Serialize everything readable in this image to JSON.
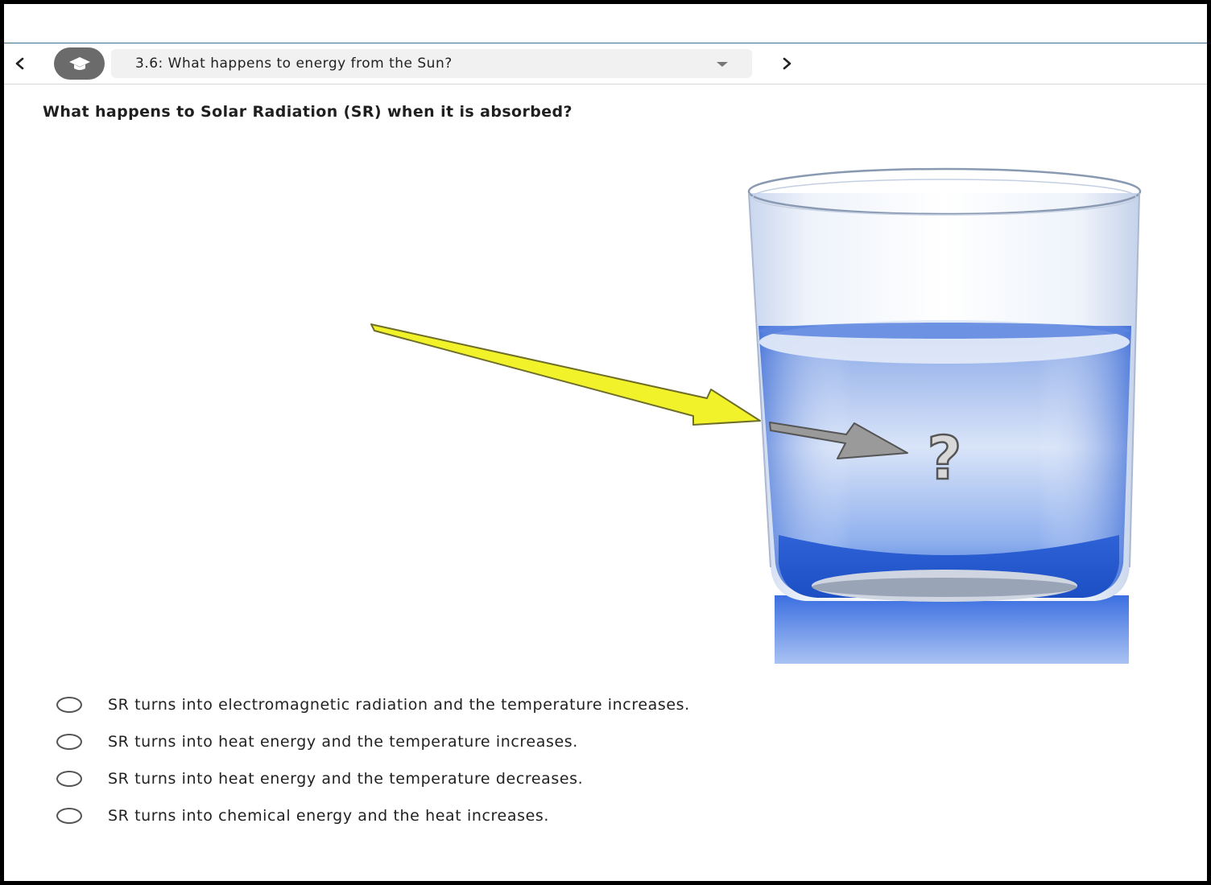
{
  "navbar": {
    "prev_icon": "chevron-left",
    "next_icon": "chevron-right",
    "cap_icon": "graduation-cap",
    "lesson_title": "3.6: What happens to energy from the Sun?"
  },
  "question": {
    "text": "What happens to Solar Radiation (SR) when it is absorbed?"
  },
  "illustration": {
    "marker": "?",
    "colors": {
      "sun_arrow": "#f2f22a",
      "absorbed_arrow": "#9a9a9a",
      "water": "#4d7de0"
    }
  },
  "options": [
    {
      "label": "SR turns into electromagnetic radiation and the temperature increases.",
      "selected": false
    },
    {
      "label": "SR turns into heat energy and the temperature increases.",
      "selected": false
    },
    {
      "label": "SR turns into heat energy and the temperature decreases.",
      "selected": false
    },
    {
      "label": "SR turns into chemical energy and the heat increases.",
      "selected": false
    }
  ]
}
